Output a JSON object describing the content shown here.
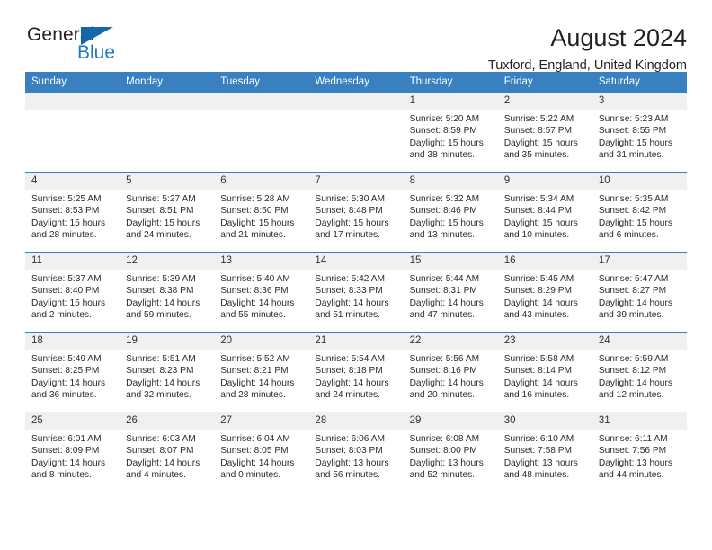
{
  "logo": {
    "word_top": "General",
    "word_bottom": "Blue",
    "triangle_color": "#1566ab",
    "blue_color": "#1f7ac4"
  },
  "header": {
    "title": "August 2024",
    "subtitle": "Tuxford, England, United Kingdom"
  },
  "theme": {
    "header_row_bg": "#3880c0",
    "header_row_text": "#ffffff",
    "daynum_bg": "#f0f0f0",
    "cell_border": "#3880c0"
  },
  "weekday_headers": [
    "Sunday",
    "Monday",
    "Tuesday",
    "Wednesday",
    "Thursday",
    "Friday",
    "Saturday"
  ],
  "labels": {
    "sunrise_prefix": "Sunrise:",
    "sunset_prefix": "Sunset:",
    "daylight_prefix": "Daylight:"
  },
  "weeks": [
    [
      {
        "day": "",
        "empty": true
      },
      {
        "day": "",
        "empty": true
      },
      {
        "day": "",
        "empty": true
      },
      {
        "day": "",
        "empty": true
      },
      {
        "day": "1",
        "sunrise": "Sunrise: 5:20 AM",
        "sunset": "Sunset: 8:59 PM",
        "daylight_line1": "Daylight: 15 hours",
        "daylight_line2": "and 38 minutes."
      },
      {
        "day": "2",
        "sunrise": "Sunrise: 5:22 AM",
        "sunset": "Sunset: 8:57 PM",
        "daylight_line1": "Daylight: 15 hours",
        "daylight_line2": "and 35 minutes."
      },
      {
        "day": "3",
        "sunrise": "Sunrise: 5:23 AM",
        "sunset": "Sunset: 8:55 PM",
        "daylight_line1": "Daylight: 15 hours",
        "daylight_line2": "and 31 minutes."
      }
    ],
    [
      {
        "day": "4",
        "sunrise": "Sunrise: 5:25 AM",
        "sunset": "Sunset: 8:53 PM",
        "daylight_line1": "Daylight: 15 hours",
        "daylight_line2": "and 28 minutes."
      },
      {
        "day": "5",
        "sunrise": "Sunrise: 5:27 AM",
        "sunset": "Sunset: 8:51 PM",
        "daylight_line1": "Daylight: 15 hours",
        "daylight_line2": "and 24 minutes."
      },
      {
        "day": "6",
        "sunrise": "Sunrise: 5:28 AM",
        "sunset": "Sunset: 8:50 PM",
        "daylight_line1": "Daylight: 15 hours",
        "daylight_line2": "and 21 minutes."
      },
      {
        "day": "7",
        "sunrise": "Sunrise: 5:30 AM",
        "sunset": "Sunset: 8:48 PM",
        "daylight_line1": "Daylight: 15 hours",
        "daylight_line2": "and 17 minutes."
      },
      {
        "day": "8",
        "sunrise": "Sunrise: 5:32 AM",
        "sunset": "Sunset: 8:46 PM",
        "daylight_line1": "Daylight: 15 hours",
        "daylight_line2": "and 13 minutes."
      },
      {
        "day": "9",
        "sunrise": "Sunrise: 5:34 AM",
        "sunset": "Sunset: 8:44 PM",
        "daylight_line1": "Daylight: 15 hours",
        "daylight_line2": "and 10 minutes."
      },
      {
        "day": "10",
        "sunrise": "Sunrise: 5:35 AM",
        "sunset": "Sunset: 8:42 PM",
        "daylight_line1": "Daylight: 15 hours",
        "daylight_line2": "and 6 minutes."
      }
    ],
    [
      {
        "day": "11",
        "sunrise": "Sunrise: 5:37 AM",
        "sunset": "Sunset: 8:40 PM",
        "daylight_line1": "Daylight: 15 hours",
        "daylight_line2": "and 2 minutes."
      },
      {
        "day": "12",
        "sunrise": "Sunrise: 5:39 AM",
        "sunset": "Sunset: 8:38 PM",
        "daylight_line1": "Daylight: 14 hours",
        "daylight_line2": "and 59 minutes."
      },
      {
        "day": "13",
        "sunrise": "Sunrise: 5:40 AM",
        "sunset": "Sunset: 8:36 PM",
        "daylight_line1": "Daylight: 14 hours",
        "daylight_line2": "and 55 minutes."
      },
      {
        "day": "14",
        "sunrise": "Sunrise: 5:42 AM",
        "sunset": "Sunset: 8:33 PM",
        "daylight_line1": "Daylight: 14 hours",
        "daylight_line2": "and 51 minutes."
      },
      {
        "day": "15",
        "sunrise": "Sunrise: 5:44 AM",
        "sunset": "Sunset: 8:31 PM",
        "daylight_line1": "Daylight: 14 hours",
        "daylight_line2": "and 47 minutes."
      },
      {
        "day": "16",
        "sunrise": "Sunrise: 5:45 AM",
        "sunset": "Sunset: 8:29 PM",
        "daylight_line1": "Daylight: 14 hours",
        "daylight_line2": "and 43 minutes."
      },
      {
        "day": "17",
        "sunrise": "Sunrise: 5:47 AM",
        "sunset": "Sunset: 8:27 PM",
        "daylight_line1": "Daylight: 14 hours",
        "daylight_line2": "and 39 minutes."
      }
    ],
    [
      {
        "day": "18",
        "sunrise": "Sunrise: 5:49 AM",
        "sunset": "Sunset: 8:25 PM",
        "daylight_line1": "Daylight: 14 hours",
        "daylight_line2": "and 36 minutes."
      },
      {
        "day": "19",
        "sunrise": "Sunrise: 5:51 AM",
        "sunset": "Sunset: 8:23 PM",
        "daylight_line1": "Daylight: 14 hours",
        "daylight_line2": "and 32 minutes."
      },
      {
        "day": "20",
        "sunrise": "Sunrise: 5:52 AM",
        "sunset": "Sunset: 8:21 PM",
        "daylight_line1": "Daylight: 14 hours",
        "daylight_line2": "and 28 minutes."
      },
      {
        "day": "21",
        "sunrise": "Sunrise: 5:54 AM",
        "sunset": "Sunset: 8:18 PM",
        "daylight_line1": "Daylight: 14 hours",
        "daylight_line2": "and 24 minutes."
      },
      {
        "day": "22",
        "sunrise": "Sunrise: 5:56 AM",
        "sunset": "Sunset: 8:16 PM",
        "daylight_line1": "Daylight: 14 hours",
        "daylight_line2": "and 20 minutes."
      },
      {
        "day": "23",
        "sunrise": "Sunrise: 5:58 AM",
        "sunset": "Sunset: 8:14 PM",
        "daylight_line1": "Daylight: 14 hours",
        "daylight_line2": "and 16 minutes."
      },
      {
        "day": "24",
        "sunrise": "Sunrise: 5:59 AM",
        "sunset": "Sunset: 8:12 PM",
        "daylight_line1": "Daylight: 14 hours",
        "daylight_line2": "and 12 minutes."
      }
    ],
    [
      {
        "day": "25",
        "sunrise": "Sunrise: 6:01 AM",
        "sunset": "Sunset: 8:09 PM",
        "daylight_line1": "Daylight: 14 hours",
        "daylight_line2": "and 8 minutes."
      },
      {
        "day": "26",
        "sunrise": "Sunrise: 6:03 AM",
        "sunset": "Sunset: 8:07 PM",
        "daylight_line1": "Daylight: 14 hours",
        "daylight_line2": "and 4 minutes."
      },
      {
        "day": "27",
        "sunrise": "Sunrise: 6:04 AM",
        "sunset": "Sunset: 8:05 PM",
        "daylight_line1": "Daylight: 14 hours",
        "daylight_line2": "and 0 minutes."
      },
      {
        "day": "28",
        "sunrise": "Sunrise: 6:06 AM",
        "sunset": "Sunset: 8:03 PM",
        "daylight_line1": "Daylight: 13 hours",
        "daylight_line2": "and 56 minutes."
      },
      {
        "day": "29",
        "sunrise": "Sunrise: 6:08 AM",
        "sunset": "Sunset: 8:00 PM",
        "daylight_line1": "Daylight: 13 hours",
        "daylight_line2": "and 52 minutes."
      },
      {
        "day": "30",
        "sunrise": "Sunrise: 6:10 AM",
        "sunset": "Sunset: 7:58 PM",
        "daylight_line1": "Daylight: 13 hours",
        "daylight_line2": "and 48 minutes."
      },
      {
        "day": "31",
        "sunrise": "Sunrise: 6:11 AM",
        "sunset": "Sunset: 7:56 PM",
        "daylight_line1": "Daylight: 13 hours",
        "daylight_line2": "and 44 minutes."
      }
    ]
  ]
}
